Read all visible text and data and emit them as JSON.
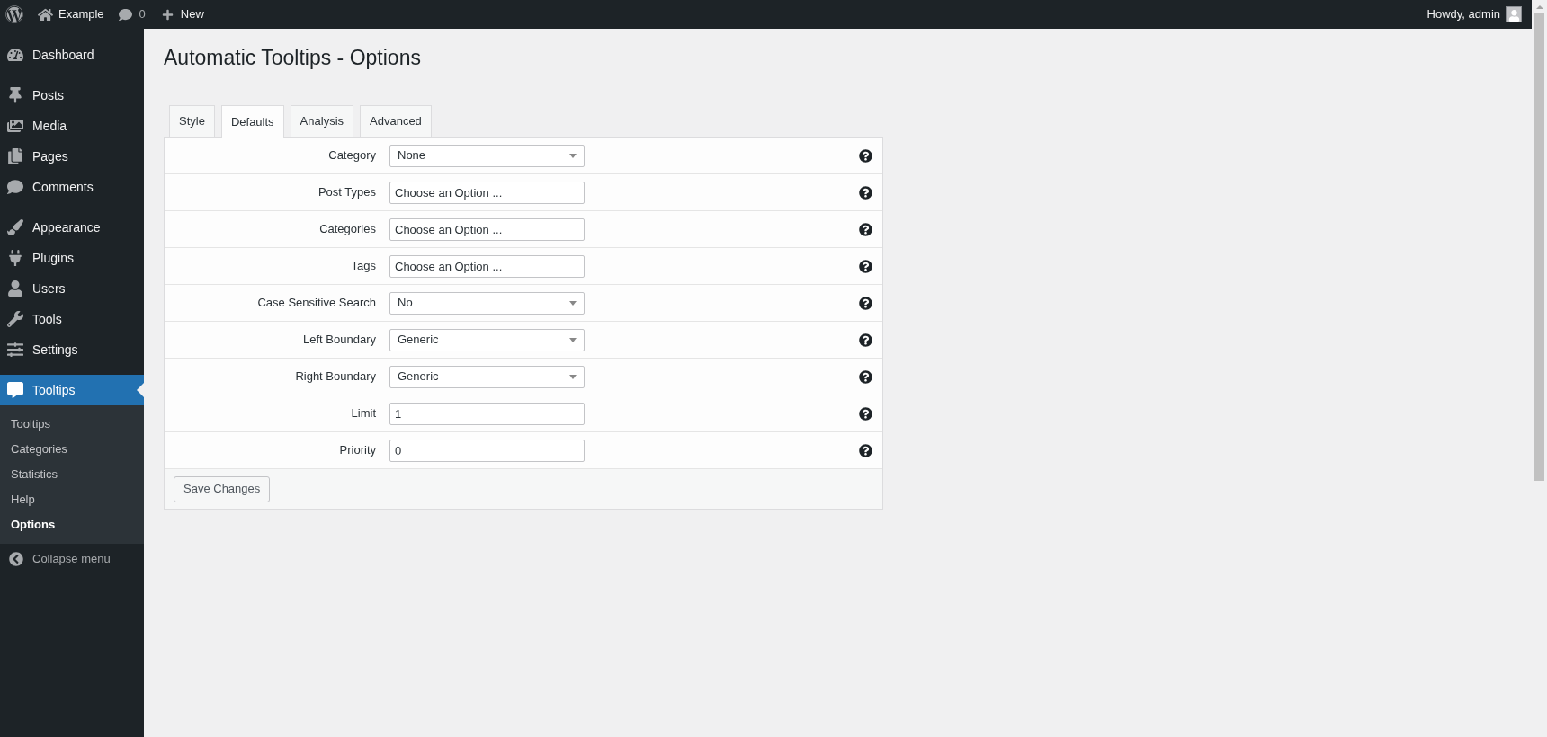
{
  "top_bar": {
    "site_name": "Example",
    "comments_count": "0",
    "new_label": "New",
    "greeting": "Howdy, admin"
  },
  "sidebar": {
    "items": [
      {
        "label": "Dashboard",
        "selected": false
      },
      {
        "label": "Posts",
        "selected": false
      },
      {
        "label": "Media",
        "selected": false
      },
      {
        "label": "Pages",
        "selected": false
      },
      {
        "label": "Comments",
        "selected": false
      },
      {
        "label": "Appearance",
        "selected": false
      },
      {
        "label": "Plugins",
        "selected": false
      },
      {
        "label": "Users",
        "selected": false
      },
      {
        "label": "Tools",
        "selected": false
      },
      {
        "label": "Settings",
        "selected": false
      },
      {
        "label": "Tooltips",
        "selected": true,
        "children": [
          {
            "label": "Tooltips",
            "selected": false
          },
          {
            "label": "Categories",
            "selected": false
          },
          {
            "label": "Statistics",
            "selected": false
          },
          {
            "label": "Help",
            "selected": false
          },
          {
            "label": "Options",
            "selected": true
          }
        ]
      }
    ],
    "collapse_label": "Collapse menu"
  },
  "page": {
    "title": "Automatic Tooltips - Options",
    "tabs": [
      {
        "label": "Style",
        "selected": false
      },
      {
        "label": "Defaults",
        "selected": true
      },
      {
        "label": "Analysis",
        "selected": false
      },
      {
        "label": "Advanced",
        "selected": false
      }
    ],
    "fields": [
      {
        "label": "Category",
        "kind": "select",
        "value": "None"
      },
      {
        "label": "Post Types",
        "kind": "multiselect",
        "placeholder": "Choose an Option ..."
      },
      {
        "label": "Categories",
        "kind": "multiselect",
        "placeholder": "Choose an Option ..."
      },
      {
        "label": "Tags",
        "kind": "multiselect",
        "placeholder": "Choose an Option ..."
      },
      {
        "label": "Case Sensitive Search",
        "kind": "select",
        "value": "No"
      },
      {
        "label": "Left Boundary",
        "kind": "select",
        "value": "Generic"
      },
      {
        "label": "Right Boundary",
        "kind": "select",
        "value": "Generic"
      },
      {
        "label": "Limit",
        "kind": "text",
        "value": "1"
      },
      {
        "label": "Priority",
        "kind": "text",
        "value": "0"
      }
    ],
    "save_button": "Save Changes"
  }
}
